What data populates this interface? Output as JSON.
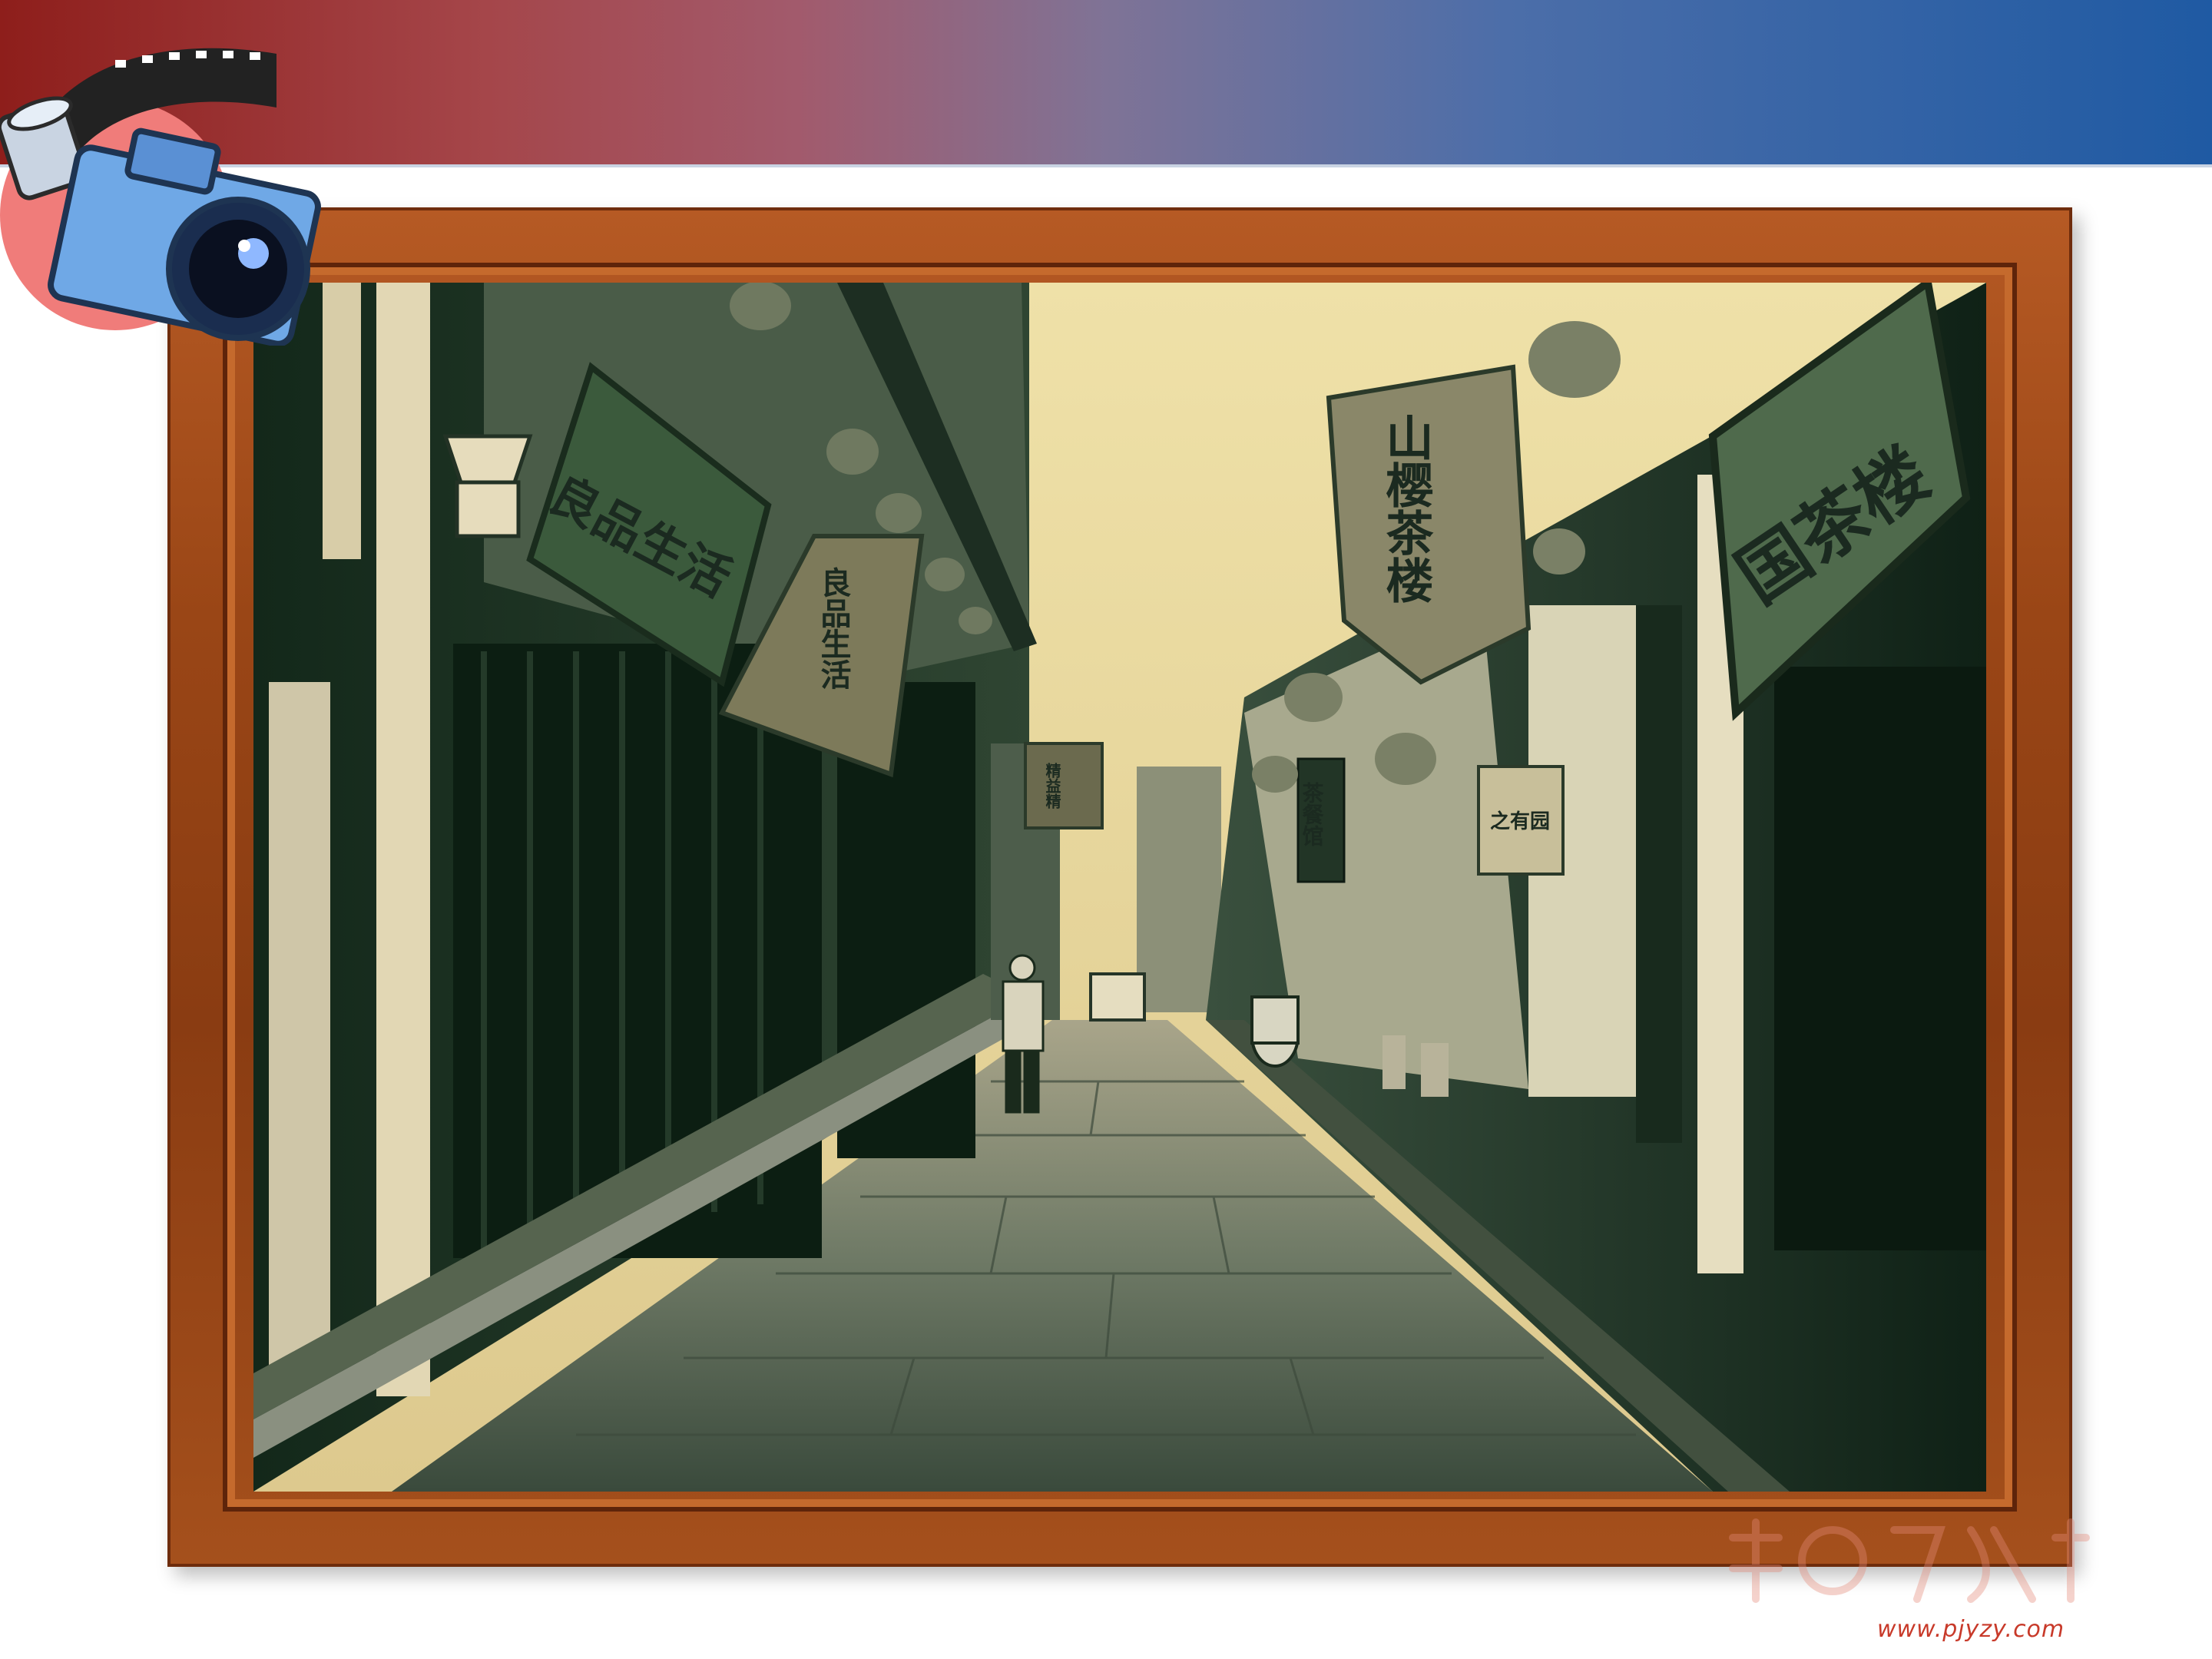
{
  "slide": {
    "watermark_url": "www.pjyzy.com"
  },
  "photo": {
    "signs": {
      "left_board": "良品生活",
      "left_banner": "良品生活",
      "right_banner": "山樱茶楼",
      "right_board": "国茶楼",
      "far_banner": "精益精",
      "tea_sign": "茶餐馆",
      "small_sign": "之有园"
    }
  },
  "colors": {
    "banner_left": "#8e1e1b",
    "banner_right": "#1f5aa3",
    "frame_wood": "#9a4616",
    "sky_sepia": "#e8d8a0",
    "shadow_green": "#17301f"
  },
  "icons": [
    "camera-icon",
    "film-roll-icon",
    "watermark-logo"
  ]
}
